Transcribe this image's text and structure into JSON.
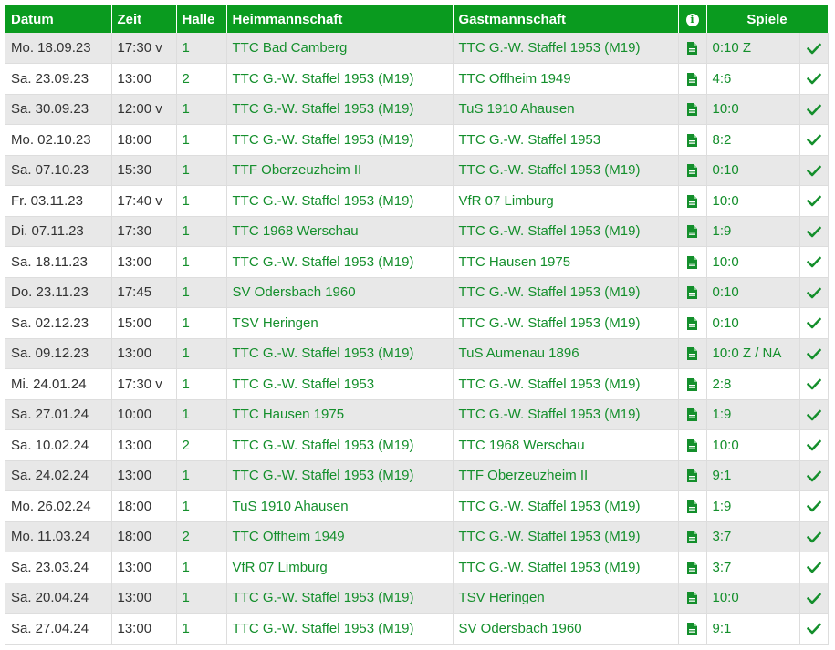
{
  "header": {
    "datum": "Datum",
    "zeit": "Zeit",
    "halle": "Halle",
    "heim": "Heimmannschaft",
    "gast": "Gastmannschaft",
    "info": "i",
    "spiele": "Spiele"
  },
  "colors": {
    "header_bg": "#0a9b1f",
    "link": "#148f2c",
    "row_alt": "#e8e8e8"
  },
  "icons": {
    "report": "document-icon",
    "confirmed": "checkmark-icon",
    "info": "info-icon"
  },
  "rows": [
    {
      "datum": "Mo. 18.09.23",
      "zeit": "17:30 v",
      "halle": "1",
      "heim": "TTC Bad Camberg",
      "gast": "TTC G.-W. Staffel 1953 (M19)",
      "spiele": "0:10 Z"
    },
    {
      "datum": "Sa. 23.09.23",
      "zeit": "13:00",
      "halle": "2",
      "heim": "TTC G.-W. Staffel 1953 (M19)",
      "gast": "TTC Offheim 1949",
      "spiele": "4:6"
    },
    {
      "datum": "Sa. 30.09.23",
      "zeit": "12:00 v",
      "halle": "1",
      "heim": "TTC G.-W. Staffel 1953 (M19)",
      "gast": "TuS 1910 Ahausen",
      "spiele": "10:0"
    },
    {
      "datum": "Mo. 02.10.23",
      "zeit": "18:00",
      "halle": "1",
      "heim": "TTC G.-W. Staffel 1953 (M19)",
      "gast": "TTC G.-W. Staffel 1953",
      "spiele": "8:2"
    },
    {
      "datum": "Sa. 07.10.23",
      "zeit": "15:30",
      "halle": "1",
      "heim": "TTF Oberzeuzheim II",
      "gast": "TTC G.-W. Staffel 1953 (M19)",
      "spiele": "0:10"
    },
    {
      "datum": "Fr. 03.11.23",
      "zeit": "17:40 v",
      "halle": "1",
      "heim": "TTC G.-W. Staffel 1953 (M19)",
      "gast": "VfR 07 Limburg",
      "spiele": "10:0"
    },
    {
      "datum": "Di. 07.11.23",
      "zeit": "17:30",
      "halle": "1",
      "heim": "TTC 1968 Werschau",
      "gast": "TTC G.-W. Staffel 1953 (M19)",
      "spiele": "1:9"
    },
    {
      "datum": "Sa. 18.11.23",
      "zeit": "13:00",
      "halle": "1",
      "heim": "TTC G.-W. Staffel 1953 (M19)",
      "gast": "TTC Hausen 1975",
      "spiele": "10:0"
    },
    {
      "datum": "Do. 23.11.23",
      "zeit": "17:45",
      "halle": "1",
      "heim": "SV Odersbach 1960",
      "gast": "TTC G.-W. Staffel 1953 (M19)",
      "spiele": "0:10"
    },
    {
      "datum": "Sa. 02.12.23",
      "zeit": "15:00",
      "halle": "1",
      "heim": "TSV Heringen",
      "gast": "TTC G.-W. Staffel 1953 (M19)",
      "spiele": "0:10"
    },
    {
      "datum": "Sa. 09.12.23",
      "zeit": "13:00",
      "halle": "1",
      "heim": "TTC G.-W. Staffel 1953 (M19)",
      "gast": "TuS Aumenau 1896",
      "spiele": "10:0 Z / NA"
    },
    {
      "datum": "Mi. 24.01.24",
      "zeit": "17:30 v",
      "halle": "1",
      "heim": "TTC G.-W. Staffel 1953",
      "gast": "TTC G.-W. Staffel 1953 (M19)",
      "spiele": "2:8"
    },
    {
      "datum": "Sa. 27.01.24",
      "zeit": "10:00",
      "halle": "1",
      "heim": "TTC Hausen 1975",
      "gast": "TTC G.-W. Staffel 1953 (M19)",
      "spiele": "1:9"
    },
    {
      "datum": "Sa. 10.02.24",
      "zeit": "13:00",
      "halle": "2",
      "heim": "TTC G.-W. Staffel 1953 (M19)",
      "gast": "TTC 1968 Werschau",
      "spiele": "10:0"
    },
    {
      "datum": "Sa. 24.02.24",
      "zeit": "13:00",
      "halle": "1",
      "heim": "TTC G.-W. Staffel 1953 (M19)",
      "gast": "TTF Oberzeuzheim II",
      "spiele": "9:1"
    },
    {
      "datum": "Mo. 26.02.24",
      "zeit": "18:00",
      "halle": "1",
      "heim": "TuS 1910 Ahausen",
      "gast": "TTC G.-W. Staffel 1953 (M19)",
      "spiele": "1:9"
    },
    {
      "datum": "Mo. 11.03.24",
      "zeit": "18:00",
      "halle": "2",
      "heim": "TTC Offheim 1949",
      "gast": "TTC G.-W. Staffel 1953 (M19)",
      "spiele": "3:7"
    },
    {
      "datum": "Sa. 23.03.24",
      "zeit": "13:00",
      "halle": "1",
      "heim": "VfR 07 Limburg",
      "gast": "TTC G.-W. Staffel 1953 (M19)",
      "spiele": "3:7"
    },
    {
      "datum": "Sa. 20.04.24",
      "zeit": "13:00",
      "halle": "1",
      "heim": "TTC G.-W. Staffel 1953 (M19)",
      "gast": "TSV Heringen",
      "spiele": "10:0"
    },
    {
      "datum": "Sa. 27.04.24",
      "zeit": "13:00",
      "halle": "1",
      "heim": "TTC G.-W. Staffel 1953 (M19)",
      "gast": "SV Odersbach 1960",
      "spiele": "9:1"
    }
  ]
}
